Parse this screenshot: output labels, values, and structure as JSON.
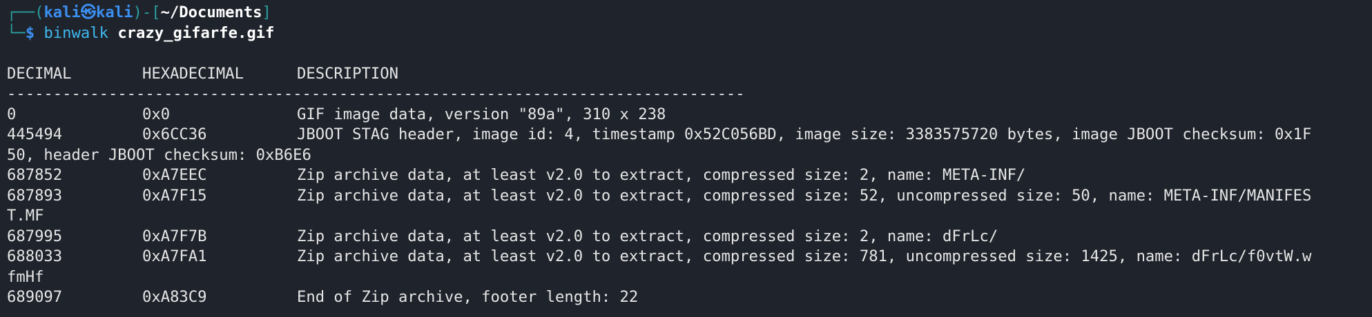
{
  "prompt": {
    "frame_top": "┌──(",
    "user": "kali㉿kali",
    "frame_mid": ")-[",
    "path": "~/Documents",
    "frame_end": "]",
    "frame_bottom": "└─",
    "dollar": "$",
    "command": "binwalk",
    "argument": "crazy_gifarfe.gif"
  },
  "table": {
    "headers": [
      "DECIMAL",
      "HEXADECIMAL",
      "DESCRIPTION"
    ],
    "separator": "--------------------------------------------------------------------------------",
    "rows": [
      {
        "decimal": "0",
        "hex": "0x0",
        "desc": "GIF image data, version \"89a\", 310 x 238",
        "cont": ""
      },
      {
        "decimal": "445494",
        "hex": "0x6CC36",
        "desc": "JBOOT STAG header, image id: 4, timestamp 0x52C056BD, image size: 3383575720 bytes, image JBOOT checksum: 0x1F",
        "cont": "50, header JBOOT checksum: 0xB6E6"
      },
      {
        "decimal": "687852",
        "hex": "0xA7EEC",
        "desc": "Zip archive data, at least v2.0 to extract, compressed size: 2, name: META-INF/",
        "cont": ""
      },
      {
        "decimal": "687893",
        "hex": "0xA7F15",
        "desc": "Zip archive data, at least v2.0 to extract, compressed size: 52, uncompressed size: 50, name: META-INF/MANIFES",
        "cont": "T.MF"
      },
      {
        "decimal": "687995",
        "hex": "0xA7F7B",
        "desc": "Zip archive data, at least v2.0 to extract, compressed size: 2, name: dFrLc/",
        "cont": ""
      },
      {
        "decimal": "688033",
        "hex": "0xA7FA1",
        "desc": "Zip archive data, at least v2.0 to extract, compressed size: 781, uncompressed size: 1425, name: dFrLc/f0vtW.w",
        "cont": "fmHf"
      },
      {
        "decimal": "689097",
        "hex": "0xA83C9",
        "desc": "End of Zip archive, footer length: 22",
        "cont": ""
      }
    ]
  }
}
